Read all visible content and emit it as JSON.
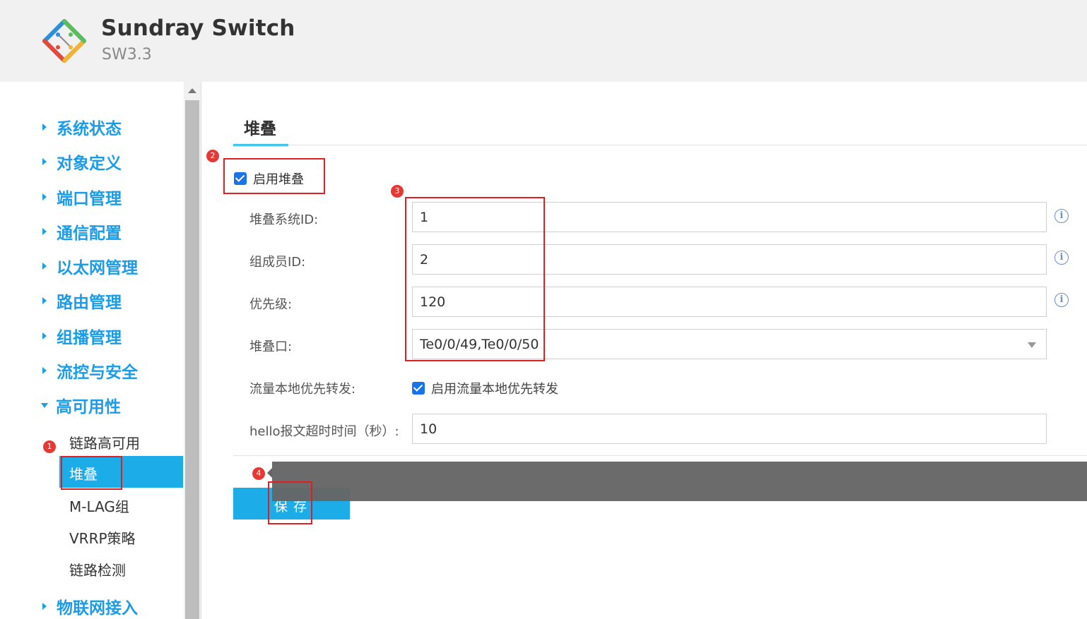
{
  "header": {
    "title": "Sundray Switch",
    "version": "SW3.3"
  },
  "sidebar": {
    "items": [
      {
        "label": "系统状态"
      },
      {
        "label": "对象定义"
      },
      {
        "label": "端口管理"
      },
      {
        "label": "通信配置"
      },
      {
        "label": "以太网管理"
      },
      {
        "label": "路由管理"
      },
      {
        "label": "组播管理"
      },
      {
        "label": "流控与安全"
      },
      {
        "label": "高可用性",
        "expanded": true
      },
      {
        "label": "物联网接入"
      }
    ],
    "subitems": [
      {
        "label": "链路高可用"
      },
      {
        "label": "堆叠",
        "active": true
      },
      {
        "label": "M-LAG组"
      },
      {
        "label": "VRRP策略"
      },
      {
        "label": "链路检测"
      }
    ]
  },
  "main": {
    "tab": "堆叠",
    "enable_label": "启用堆叠",
    "fields": {
      "system_id": {
        "label": "堆叠系统ID:",
        "value": "1"
      },
      "member_id": {
        "label": "组成员ID:",
        "value": "2"
      },
      "priority": {
        "label": "优先级:",
        "value": "120"
      },
      "stack_port": {
        "label": "堆叠口:",
        "value": "Te0/0/49,Te0/0/50"
      },
      "local_forward": {
        "label": "流量本地优先转发:",
        "checkbox_label": "启用流量本地优先转发"
      },
      "hello_timeout": {
        "label": "hello报文超时时间（秒）:",
        "value": "10"
      }
    },
    "save_label": "保存"
  },
  "annotations": [
    "1",
    "2",
    "3",
    "4"
  ],
  "colors": {
    "accent": "#1cace8",
    "nav_text": "#1a9ce8",
    "annotation_red": "#e02020",
    "tooltip_bg": "#666666"
  }
}
